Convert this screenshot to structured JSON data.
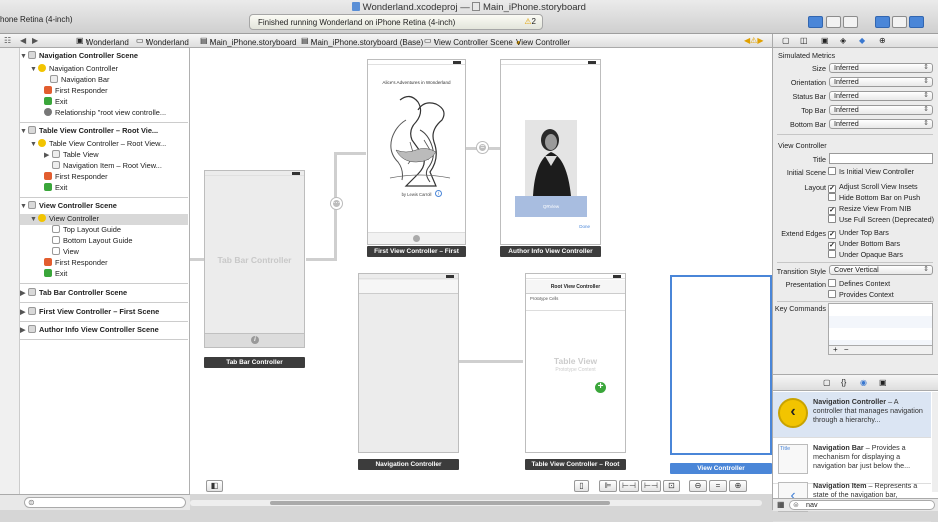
{
  "window": {
    "title_project": "Wonderland.xcodeproj",
    "title_sep": "—",
    "title_file": "Main_iPhone.storyboard",
    "scheme": "hone Retina (4-inch)",
    "activity": "Finished running Wonderland on iPhone Retina (4-inch)",
    "warnings": "2"
  },
  "jumpbar": {
    "items": [
      "Wonderland",
      "Wonderland",
      "Main_iPhone.storyboard",
      "Main_iPhone.storyboard (Base)",
      "View Controller Scene",
      "View Controller"
    ]
  },
  "outline": {
    "rows": [
      {
        "text": "Navigation Controller Scene",
        "kind": "head"
      },
      {
        "text": "Navigation Controller",
        "kind": "item"
      },
      {
        "text": "Navigation Bar",
        "kind": "item"
      },
      {
        "text": "First Responder",
        "kind": "item"
      },
      {
        "text": "Exit",
        "kind": "item"
      },
      {
        "text": "Relationship \"root view controlle...",
        "kind": "item"
      },
      {
        "text": "Table View Controller – Root Vie...",
        "kind": "head"
      },
      {
        "text": "Table View Controller – Root View...",
        "kind": "item"
      },
      {
        "text": "Table View",
        "kind": "item"
      },
      {
        "text": "Navigation Item – Root View...",
        "kind": "item"
      },
      {
        "text": "First Responder",
        "kind": "item"
      },
      {
        "text": "Exit",
        "kind": "item"
      },
      {
        "text": "View Controller Scene",
        "kind": "head"
      },
      {
        "text": "View Controller",
        "kind": "item"
      },
      {
        "text": "Top Layout Guide",
        "kind": "item"
      },
      {
        "text": "Bottom Layout Guide",
        "kind": "item"
      },
      {
        "text": "View",
        "kind": "item"
      },
      {
        "text": "First Responder",
        "kind": "item"
      },
      {
        "text": "Exit",
        "kind": "item"
      },
      {
        "text": "Tab Bar Controller Scene",
        "kind": "head"
      },
      {
        "text": "First View Controller – First Scene",
        "kind": "head"
      },
      {
        "text": "Author Info View Controller Scene",
        "kind": "head"
      }
    ]
  },
  "canvas": {
    "tabbar_placeholder": "Tab Bar Controller",
    "book_title": "Alice's Adventures in Wonderland",
    "book_author": "by Lewis Carroll",
    "qrview": "QRView",
    "done": "Done",
    "root_vc_title": "Root View Controller",
    "prototype_cells": "Prototype Cells",
    "table_view": "Table View",
    "prototype_content": "Prototype Content",
    "labels": {
      "tabbar": "Tab Bar Controller",
      "first": "First View Controller – First",
      "author": "Author Info View Controller",
      "nav": "Navigation Controller",
      "table": "Table View Controller – Root",
      "vc": "View Controller"
    }
  },
  "inspector": {
    "simulated_metrics": "Simulated Metrics",
    "metrics": [
      {
        "label": "Size",
        "value": "Inferred"
      },
      {
        "label": "Orientation",
        "value": "Inferred"
      },
      {
        "label": "Status Bar",
        "value": "Inferred"
      },
      {
        "label": "Top Bar",
        "value": "Inferred"
      },
      {
        "label": "Bottom Bar",
        "value": "Inferred"
      }
    ],
    "view_controller": "View Controller",
    "title_label": "Title",
    "title_value": "",
    "initial_scene_label": "Initial Scene",
    "is_initial": "Is Initial View Controller",
    "layout_label": "Layout",
    "layout_opts": [
      {
        "text": "Adjust Scroll View Insets",
        "checked": true
      },
      {
        "text": "Hide Bottom Bar on Push",
        "checked": false
      },
      {
        "text": "Resize View From NIB",
        "checked": true
      },
      {
        "text": "Use Full Screen (Deprecated)",
        "checked": false
      }
    ],
    "extend_label": "Extend Edges",
    "extend_opts": [
      {
        "text": "Under Top Bars",
        "checked": true
      },
      {
        "text": "Under Bottom Bars",
        "checked": true
      },
      {
        "text": "Under Opaque Bars",
        "checked": false
      }
    ],
    "transition_label": "Transition Style",
    "transition_value": "Cover Vertical",
    "presentation_label": "Presentation",
    "presentation_opts": [
      {
        "text": "Defines Context",
        "checked": false
      },
      {
        "text": "Provides Context",
        "checked": false
      }
    ],
    "key_commands": "Key Commands",
    "add": "+",
    "remove": "−"
  },
  "library": {
    "items": [
      {
        "name": "Navigation Controller",
        "desc": " – A controller that manages navigation through a hierarchy..."
      },
      {
        "name": "Navigation Bar",
        "desc": " – Provides a mechanism for displaying a navigation bar just below the..."
      },
      {
        "name": "Navigation Item",
        "desc": " – Represents a state of the navigation bar,"
      }
    ],
    "search": "nav",
    "title_tag": "Title"
  },
  "colors": {
    "accent": "#4a86d8",
    "scene_label": "#3c3c3c",
    "selection": "#d8d8d8"
  }
}
